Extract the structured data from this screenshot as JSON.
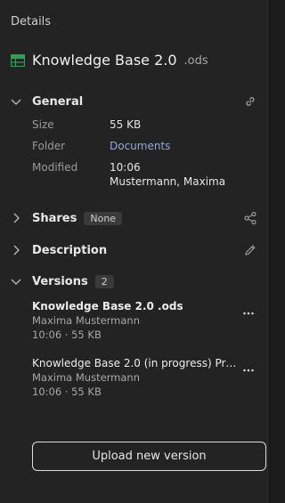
{
  "header": {
    "title": "Details"
  },
  "file": {
    "icon": "spreadsheet-icon",
    "name": "Knowledge Base 2.0",
    "extension": ".ods",
    "icon_color": "#2e9e5a"
  },
  "general": {
    "label": "General",
    "action_icon": "link-icon",
    "size_label": "Size",
    "size_value": "55 KB",
    "folder_label": "Folder",
    "folder_value": "Documents",
    "modified_label": "Modified",
    "modified_time": "10:06",
    "modified_by": "Mustermann, Maxima"
  },
  "shares": {
    "label": "Shares",
    "badge": "None",
    "action_icon": "share-icon"
  },
  "description": {
    "label": "Description",
    "action_icon": "pencil-icon"
  },
  "versions": {
    "label": "Versions",
    "count": "2",
    "items": [
      {
        "title": "Knowledge Base 2.0 .ods",
        "author": "Maxima Mustermann",
        "meta": "10:06 · 55 KB"
      },
      {
        "title": "Knowledge Base 2.0 (in progress) Pri...",
        "author": "Maxima Mustermann",
        "meta": "10:06 · 55 KB"
      }
    ],
    "upload_label": "Upload new version"
  },
  "colors": {
    "background": "#232323",
    "link": "#8fa8e6"
  }
}
